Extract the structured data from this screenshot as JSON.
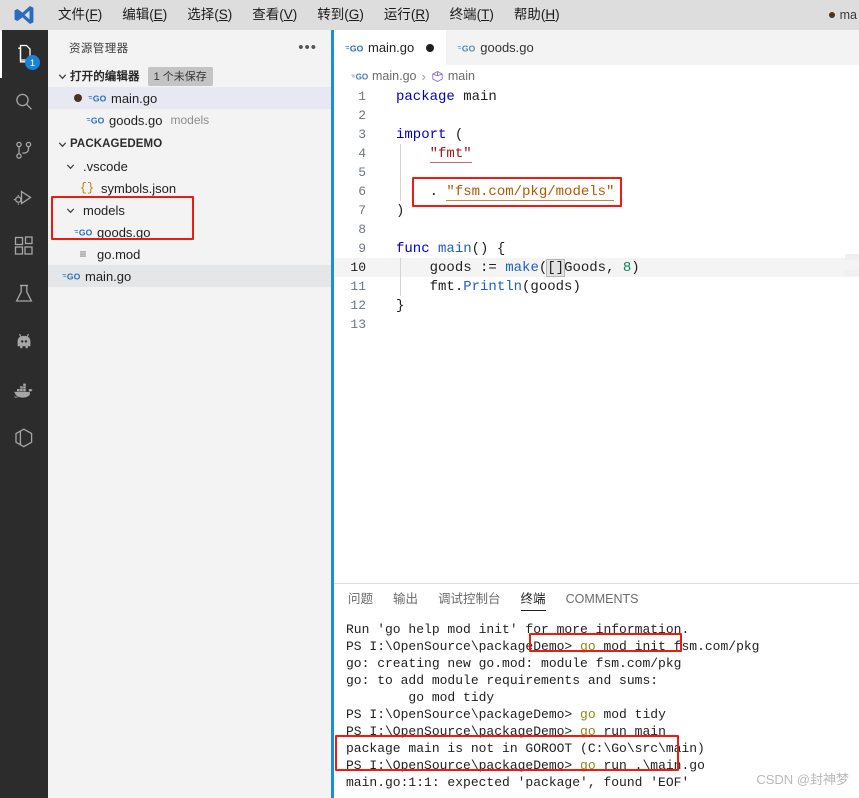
{
  "titlebar": {
    "menu": [
      {
        "label": "文件",
        "accel": "F"
      },
      {
        "label": "编辑",
        "accel": "E"
      },
      {
        "label": "选择",
        "accel": "S"
      },
      {
        "label": "查看",
        "accel": "V"
      },
      {
        "label": "转到",
        "accel": "G"
      },
      {
        "label": "运行",
        "accel": "R"
      },
      {
        "label": "终端",
        "accel": "T"
      },
      {
        "label": "帮助",
        "accel": "H"
      }
    ],
    "window_title": "ma"
  },
  "activitybar": {
    "items": [
      {
        "name": "explorer",
        "badge": "1"
      },
      {
        "name": "search",
        "badge": ""
      },
      {
        "name": "source-control",
        "badge": ""
      },
      {
        "name": "run-and-debug",
        "badge": ""
      },
      {
        "name": "extensions",
        "badge": ""
      },
      {
        "name": "testing",
        "badge": ""
      },
      {
        "name": "robot",
        "badge": ""
      },
      {
        "name": "docker",
        "badge": ""
      },
      {
        "name": "package",
        "badge": ""
      }
    ]
  },
  "sidebar": {
    "title": "资源管理器",
    "open_editors": {
      "label": "打开的编辑器",
      "badge": "1 个未保存",
      "items": [
        {
          "name": "main.go",
          "dirty": true,
          "sub": ""
        },
        {
          "name": "goods.go",
          "dirty": false,
          "sub": "models"
        }
      ]
    },
    "project": {
      "label": "PACKAGEDEMO",
      "items": [
        {
          "name": ".vscode",
          "kind": "folder",
          "indent": 1
        },
        {
          "name": "symbols.json",
          "kind": "json",
          "indent": 2
        },
        {
          "name": "models",
          "kind": "folder",
          "indent": 1
        },
        {
          "name": "goods.go",
          "kind": "go",
          "indent": 2
        },
        {
          "name": "go.mod",
          "kind": "mod",
          "indent": 2
        },
        {
          "name": "main.go",
          "kind": "go",
          "indent": 1
        }
      ]
    }
  },
  "editor": {
    "tabs": [
      {
        "label": "main.go",
        "active": true,
        "dirty": true
      },
      {
        "label": "goods.go",
        "active": false,
        "dirty": false
      }
    ],
    "breadcrumb": [
      "main.go",
      "main"
    ],
    "lines": [
      {
        "n": "1",
        "text": "package main"
      },
      {
        "n": "2",
        "text": ""
      },
      {
        "n": "3",
        "text": "import ("
      },
      {
        "n": "4",
        "text": "    \"fmt\""
      },
      {
        "n": "5",
        "text": ""
      },
      {
        "n": "6",
        "text": "    . \"fsm.com/pkg/models\""
      },
      {
        "n": "7",
        "text": ")"
      },
      {
        "n": "8",
        "text": ""
      },
      {
        "n": "9",
        "text": "func main() {"
      },
      {
        "n": "10",
        "text": "    goods := make([]Goods, 8)"
      },
      {
        "n": "11",
        "text": "    fmt.Println(goods)"
      },
      {
        "n": "12",
        "text": "}"
      },
      {
        "n": "13",
        "text": ""
      }
    ]
  },
  "panel": {
    "tabs": [
      {
        "label": "问题",
        "active": false
      },
      {
        "label": "输出",
        "active": false
      },
      {
        "label": "调试控制台",
        "active": false
      },
      {
        "label": "终端",
        "active": true
      },
      {
        "label": "COMMENTS",
        "active": false
      }
    ],
    "terminal_lines": [
      {
        "text": "Run 'go help mod init' for more information."
      },
      {
        "prompt": "PS I:\\OpenSource\\packageDemo> ",
        "cmd_go": "go",
        "cmd_rest": " mod init fsm.com/pkg"
      },
      {
        "text": "go: creating new go.mod: module fsm.com/pkg"
      },
      {
        "text": "go: to add module requirements and sums:"
      },
      {
        "text": "        go mod tidy"
      },
      {
        "prompt": "PS I:\\OpenSource\\packageDemo> ",
        "cmd_go": "go",
        "cmd_rest": " mod tidy"
      },
      {
        "prompt": "PS I:\\OpenSource\\packageDemo> ",
        "cmd_go": "go",
        "cmd_rest": " run main"
      },
      {
        "text": "package main is not in GOROOT (C:\\Go\\src\\main)"
      },
      {
        "prompt": "PS I:\\OpenSource\\packageDemo> ",
        "cmd_go": "go",
        "cmd_rest": " run .\\main.go"
      },
      {
        "text": "main.go:1:1: expected 'package', found 'EOF'"
      }
    ]
  },
  "watermark": "CSDN @封神梦",
  "colors": {
    "accent": "#1a8fe0",
    "annotation": "#ee1b11",
    "badge": "#1a85d6",
    "activitybar_bg": "#2c2c2c",
    "sidebar_bg": "#f3f3f3"
  }
}
